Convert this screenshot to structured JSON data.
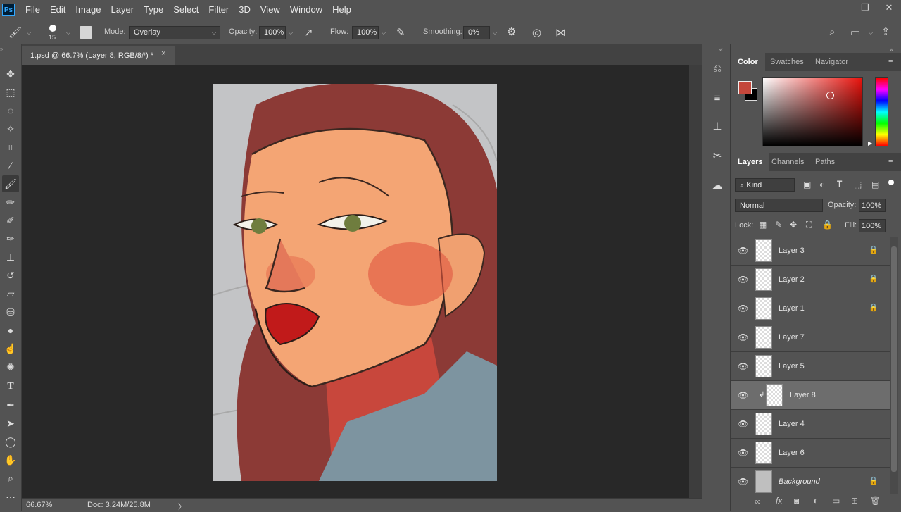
{
  "app": {
    "logo": "Ps",
    "menu": [
      "File",
      "Edit",
      "Image",
      "Layer",
      "Type",
      "Select",
      "Filter",
      "3D",
      "View",
      "Window",
      "Help"
    ],
    "window_controls": [
      "minimize-icon",
      "restore-icon",
      "close-icon"
    ]
  },
  "options_bar": {
    "brush_size": "15",
    "mode_label": "Mode:",
    "mode_value": "Overlay",
    "opacity_label": "Opacity:",
    "opacity_value": "100%",
    "flow_label": "Flow:",
    "flow_value": "100%",
    "smoothing_label": "Smoothing:",
    "smoothing_value": "0%"
  },
  "document": {
    "tab_title": "1.psd @ 66.7% (Layer 8, RGB/8#) *",
    "close": "×"
  },
  "status": {
    "zoom": "66.67%",
    "doc": "Doc: 3.24M/25.8M",
    "arrow": "〉"
  },
  "color_panel": {
    "tabs": [
      "Color",
      "Swatches",
      "Navigator"
    ],
    "foreground": "#c4473b",
    "background": "#000000"
  },
  "layers_panel": {
    "tabs": [
      "Layers",
      "Channels",
      "Paths"
    ],
    "filter_label": "Kind",
    "blend_mode": "Normal",
    "opacity_label": "Opacity:",
    "opacity_value": "100%",
    "lock_label": "Lock:",
    "fill_label": "Fill:",
    "fill_value": "100%",
    "layers": [
      {
        "name": "Layer 3",
        "locked": true
      },
      {
        "name": "Layer 2",
        "locked": true
      },
      {
        "name": "Layer 1",
        "locked": true
      },
      {
        "name": "Layer 7",
        "locked": false
      },
      {
        "name": "Layer 5",
        "locked": false
      },
      {
        "name": "Layer 8",
        "locked": false,
        "selected": true
      },
      {
        "name": "Layer 4",
        "locked": false
      },
      {
        "name": "Layer 6",
        "locked": false
      },
      {
        "name": "Background",
        "locked": true
      }
    ]
  }
}
